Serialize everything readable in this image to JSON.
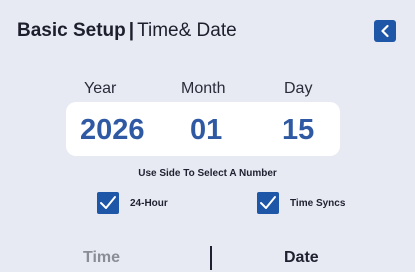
{
  "header": {
    "title": "Basic Setup",
    "separator": "|",
    "subtitle": "Time& Date",
    "back_icon": "chevron-left-icon"
  },
  "date": {
    "year_label": "Year",
    "month_label": "Month",
    "day_label": "Day",
    "year_value": "2026",
    "month_value": "01",
    "day_value": "15"
  },
  "hint": "Use Side To Select A Number",
  "options": {
    "hour24_label": "24-Hour",
    "hour24_checked": true,
    "timesync_label": "Time Syncs",
    "timesync_checked": true
  },
  "tabs": {
    "time_label": "Time",
    "date_label": "Date",
    "active": "date"
  },
  "colors": {
    "accent": "#1e56a8",
    "value_text": "#2f5aa3",
    "background": "#e8eaf3",
    "inactive_tab": "#8b8d96"
  }
}
